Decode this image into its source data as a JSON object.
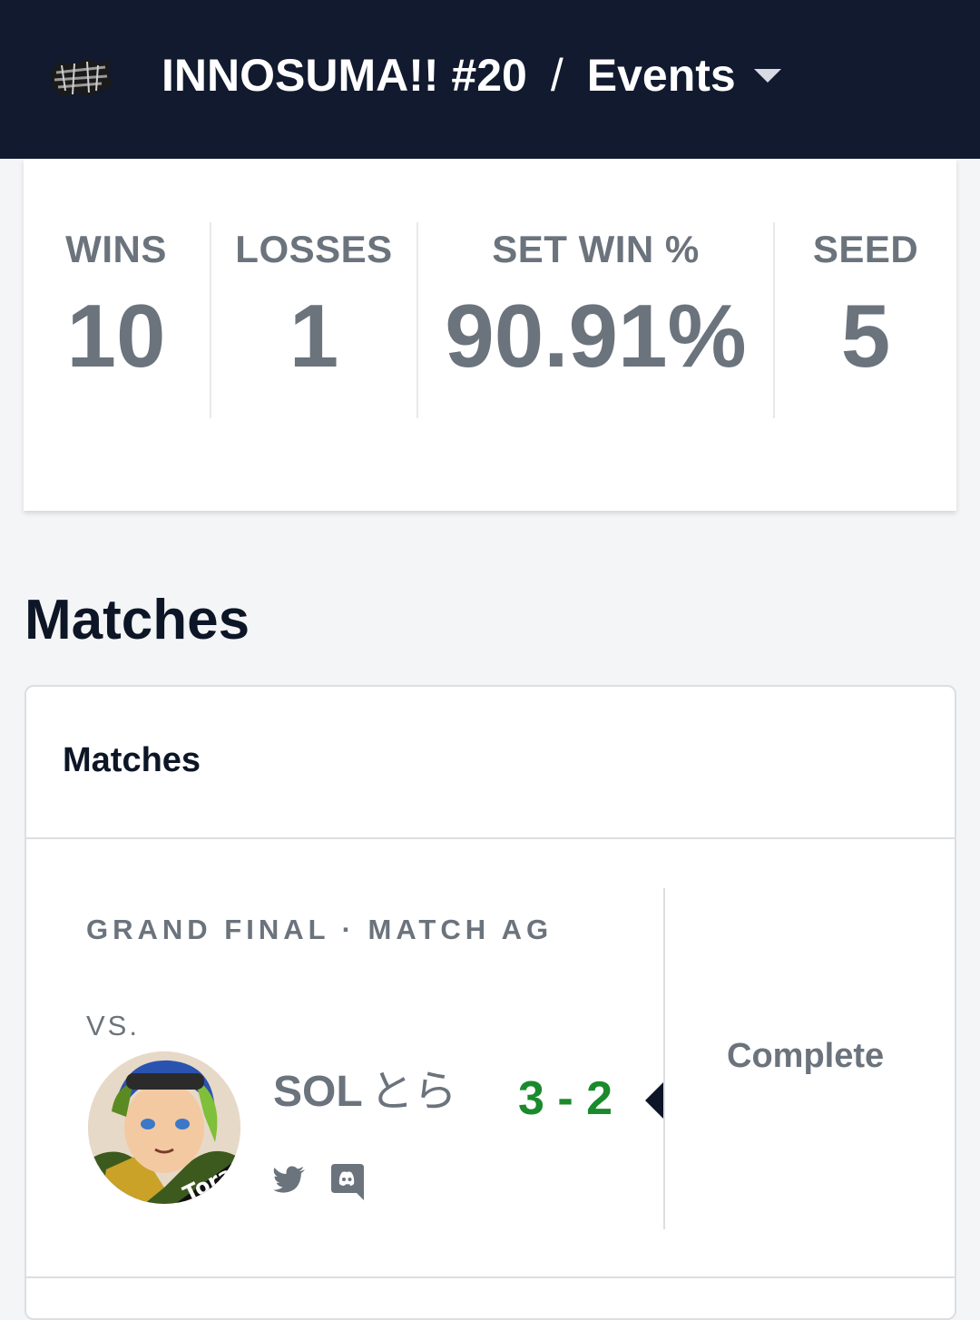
{
  "header": {
    "tournament": "INNOSUMA!! #20",
    "separator": "/",
    "section": "Events"
  },
  "stats": {
    "wins_label": "WINS",
    "wins_value": "10",
    "losses_label": "LOSSES",
    "losses_value": "1",
    "setwin_label": "SET WIN %",
    "setwin_value": "90.91%",
    "seed_label": "SEED",
    "seed_value": "5"
  },
  "matches": {
    "section_title": "Matches",
    "card_title": "Matches",
    "items": [
      {
        "round": "GRAND FINAL · MATCH AG",
        "vs": "VS.",
        "opponent_tag": "SOL",
        "opponent_name": "とら",
        "score": "3 - 2",
        "status": "Complete"
      }
    ]
  },
  "colors": {
    "header_bg": "#111a2e",
    "score_win": "#1a8a2c",
    "muted_text": "#6b737c"
  },
  "icons": [
    "tournament-logo-icon",
    "chevron-down-icon",
    "twitter-icon",
    "discord-icon",
    "selected-marker-icon"
  ]
}
